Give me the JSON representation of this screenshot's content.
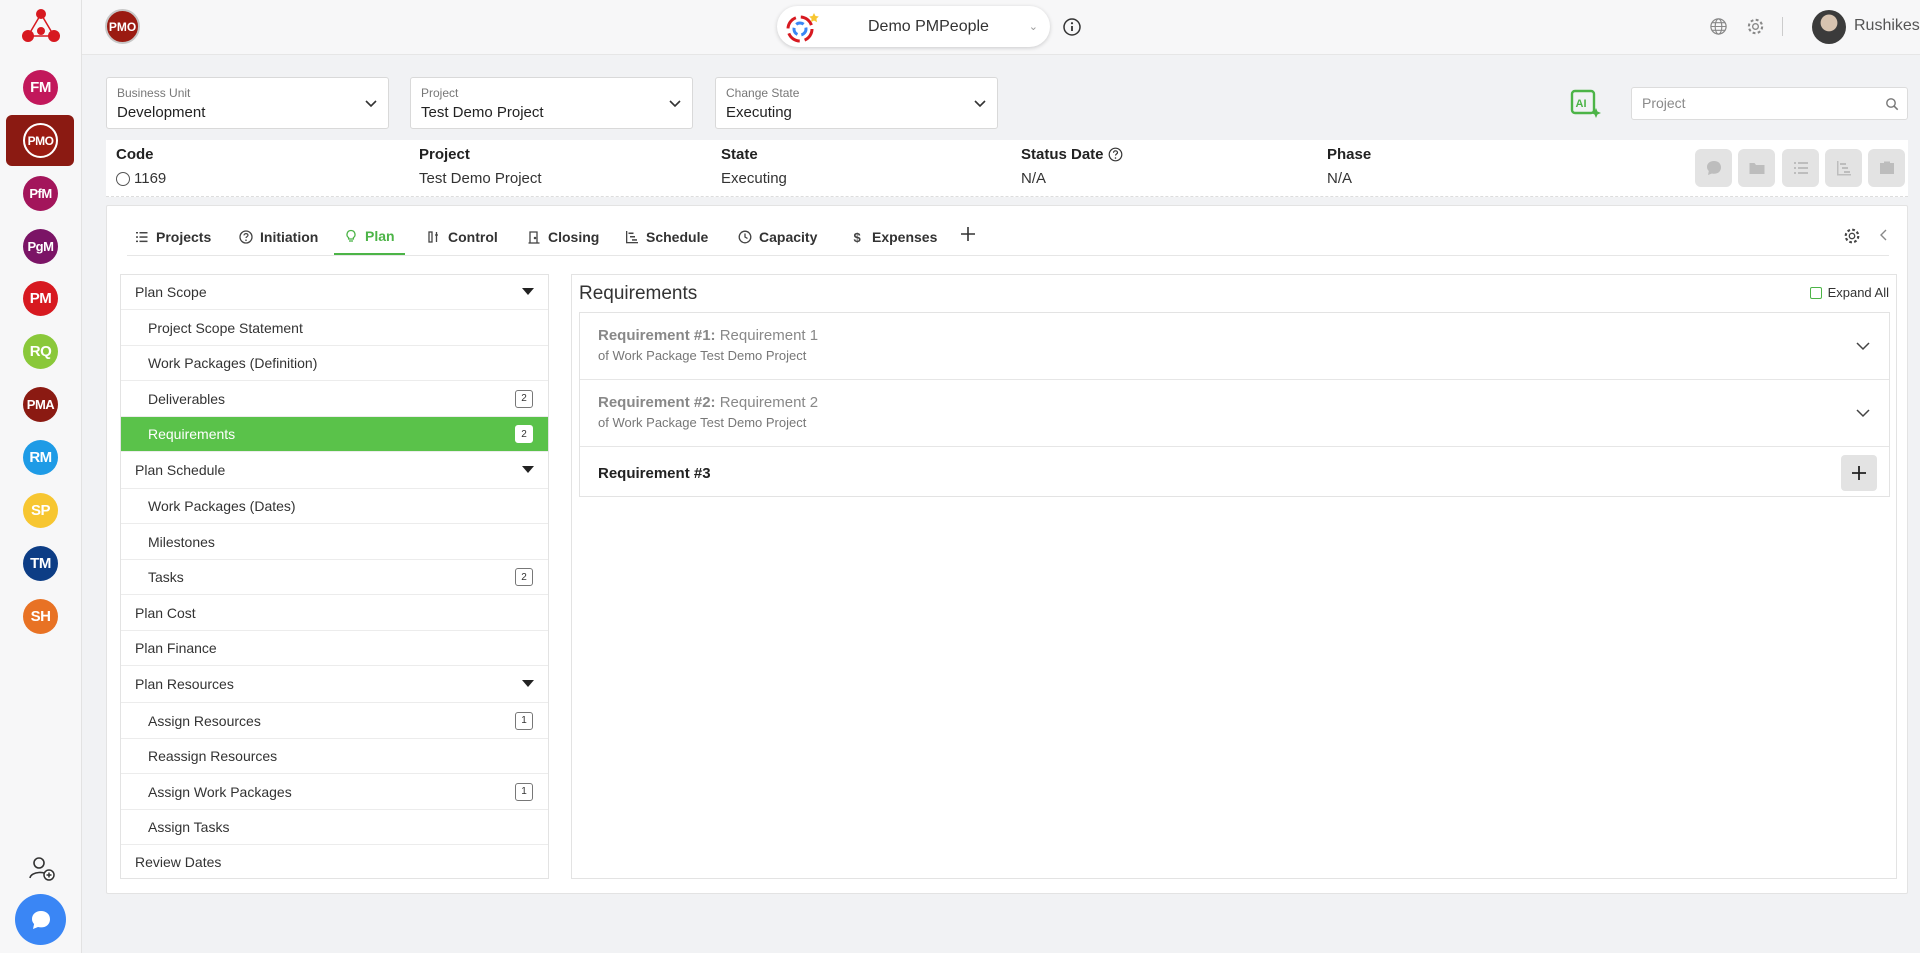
{
  "rail": {
    "items": [
      {
        "label": "FM",
        "color": "#c2185b"
      },
      {
        "label": "PMO",
        "color": "#9b1b12"
      },
      {
        "label": "PfM",
        "color": "#a3155b"
      },
      {
        "label": "PgM",
        "color": "#7b1466"
      },
      {
        "label": "PM",
        "color": "#d71920"
      },
      {
        "label": "RQ",
        "color": "#8ac83a"
      },
      {
        "label": "PMA",
        "color": "#8b1a12"
      },
      {
        "label": "RM",
        "color": "#1e9be6"
      },
      {
        "label": "SP",
        "color": "#f7c631"
      },
      {
        "label": "TM",
        "color": "#0d3d85"
      },
      {
        "label": "SH",
        "color": "#e87224"
      }
    ],
    "active": "PMO"
  },
  "topbar": {
    "module_badge": "PMO",
    "workspace_name": "Demo PMPeople",
    "user_name": "Rushikesh"
  },
  "filters": {
    "business_unit": {
      "label": "Business Unit",
      "value": "Development"
    },
    "project": {
      "label": "Project",
      "value": "Test Demo Project"
    },
    "change_state": {
      "label": "Change State",
      "value": "Executing"
    }
  },
  "search": {
    "placeholder": "Project"
  },
  "project_info": {
    "code_label": "Code",
    "code_value": "1169",
    "project_label": "Project",
    "project_value": "Test Demo Project",
    "state_label": "State",
    "state_value": "Executing",
    "status_date_label": "Status Date",
    "status_date_value": "N/A",
    "phase_label": "Phase",
    "phase_value": "N/A"
  },
  "tabs": [
    {
      "label": "Projects",
      "icon": "list-icon"
    },
    {
      "label": "Initiation",
      "icon": "question-circle-icon"
    },
    {
      "label": "Plan",
      "icon": "lightbulb-icon",
      "active": true
    },
    {
      "label": "Control",
      "icon": "control-bars-icon"
    },
    {
      "label": "Closing",
      "icon": "door-icon"
    },
    {
      "label": "Schedule",
      "icon": "gantt-icon"
    },
    {
      "label": "Capacity",
      "icon": "clock-icon"
    },
    {
      "label": "Expenses",
      "icon": "dollar-icon"
    }
  ],
  "tree": {
    "plan_scope": "Plan Scope",
    "project_scope_statement": "Project Scope Statement",
    "work_packages_definition": "Work Packages (Definition)",
    "deliverables": "Deliverables",
    "deliverables_count": "2",
    "requirements": "Requirements",
    "requirements_count": "2",
    "plan_schedule": "Plan Schedule",
    "work_packages_dates": "Work Packages (Dates)",
    "milestones": "Milestones",
    "tasks": "Tasks",
    "tasks_count": "2",
    "plan_cost": "Plan Cost",
    "plan_finance": "Plan Finance",
    "plan_resources": "Plan Resources",
    "assign_resources": "Assign Resources",
    "assign_resources_count": "1",
    "reassign_resources": "Reassign Resources",
    "assign_work_packages": "Assign Work Packages",
    "assign_work_packages_count": "1",
    "assign_tasks": "Assign Tasks",
    "review_dates": "Review Dates"
  },
  "requirements_panel": {
    "title": "Requirements",
    "expand_all": "Expand All",
    "items": [
      {
        "label": "Requirement #1:",
        "name": "Requirement 1",
        "sub": "of Work Package Test Demo Project"
      },
      {
        "label": "Requirement #2:",
        "name": "Requirement 2",
        "sub": "of Work Package Test Demo Project"
      }
    ],
    "new_item": "Requirement #3"
  },
  "colors": {
    "accent": "#5ac24a",
    "brand": "#9b1b12"
  }
}
